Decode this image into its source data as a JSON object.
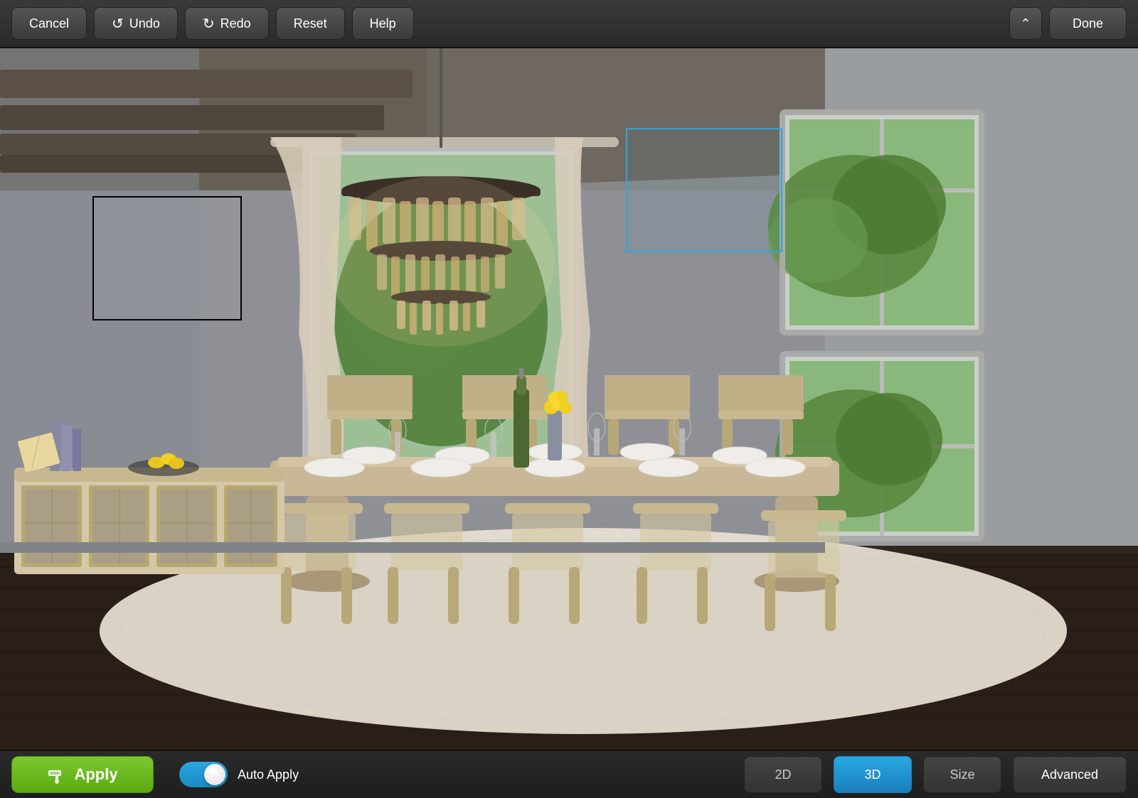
{
  "toolbar": {
    "cancel_label": "Cancel",
    "undo_label": "Undo",
    "redo_label": "Redo",
    "reset_label": "Reset",
    "help_label": "Help",
    "done_label": "Done"
  },
  "bottom_toolbar": {
    "apply_label": "Apply",
    "auto_apply_label": "Auto Apply",
    "mode_2d_label": "2D",
    "mode_3d_label": "3D",
    "size_label": "Size",
    "advanced_label": "Advanced",
    "active_mode": "3D"
  },
  "scene": {
    "selection_boxes": [
      {
        "type": "black",
        "description": "Wall art frame top-left"
      },
      {
        "type": "blue",
        "description": "Window selection top-right"
      }
    ]
  }
}
